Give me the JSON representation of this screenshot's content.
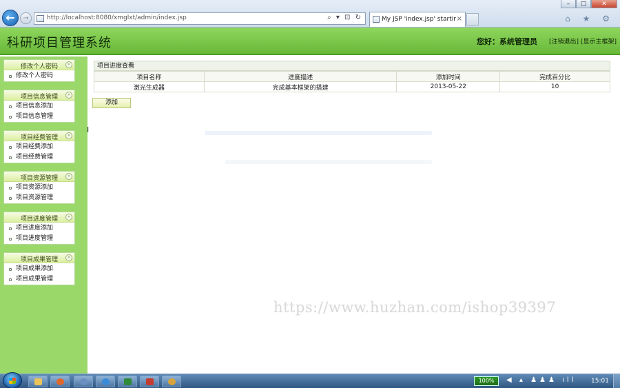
{
  "browser": {
    "address_url": "http://localhost:8080/xmglxt/admin/index.jsp",
    "tab_title": "My JSP 'index.jsp' startin...",
    "tab_close": "×",
    "back_arrow": "←",
    "forward_arrow": "→",
    "addr_tools": "⌕ ▾ ⊡ ↻",
    "right_icons": "⌂ ★ ⚙",
    "win_min": "–",
    "win_max": "□",
    "win_close": "✕"
  },
  "header": {
    "title": "科研项目管理系统",
    "greeting": "您好：系统管理员",
    "logout": "[注销退出]",
    "home": "[显示主框架]"
  },
  "sidebar": {
    "collapse_glyph": "«",
    "groups": [
      {
        "label": "修改个人密码",
        "items": [
          "修改个人密码"
        ]
      },
      {
        "label": "项目信息管理",
        "items": [
          "项目信息添加",
          "项目信息管理"
        ]
      },
      {
        "label": "项目经费管理",
        "items": [
          "项目经费添加",
          "项目经费管理"
        ]
      },
      {
        "label": "项目资源管理",
        "items": [
          "项目资源添加",
          "项目资源管理"
        ]
      },
      {
        "label": "项目进度管理",
        "items": [
          "项目进度添加",
          "项目进度管理"
        ]
      },
      {
        "label": "项目成果管理",
        "items": [
          "项目成果添加",
          "项目成果管理"
        ]
      }
    ]
  },
  "main": {
    "panel_title": "项目进度查看",
    "columns": [
      "项目名称",
      "进度描述",
      "添加时间",
      "完成百分比"
    ],
    "rows": [
      [
        "激光生成器",
        "完成基本框架的搭建",
        "2013-05-22",
        "10"
      ]
    ],
    "add_button": "添加",
    "cursor_glyph": "I",
    "watermark": "https://www.huzhan.com/ishop39397"
  },
  "taskbar": {
    "battery": "100%",
    "tray_icons": "◀ ▴ ♟♟♟ ıll",
    "clock": "15:01"
  },
  "colors": {
    "header_green": "#7cc84a",
    "sidebar_green": "#9ad86a",
    "taskbar_blue": "#3f6a96"
  }
}
